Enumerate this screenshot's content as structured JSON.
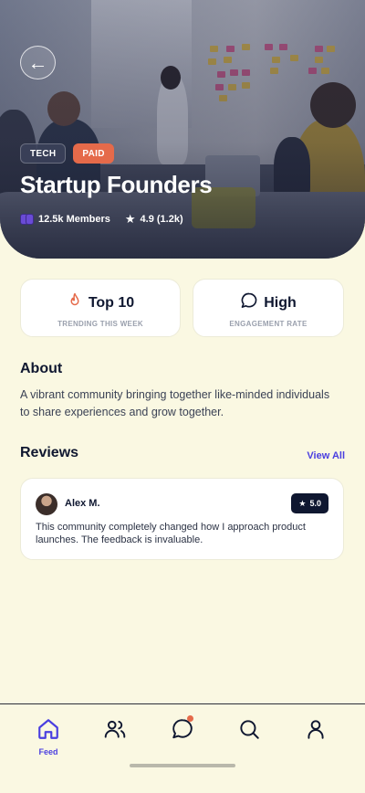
{
  "hero": {
    "back_icon": "arrow-left-icon",
    "tags": [
      "TECH",
      "PAID"
    ],
    "title": "Startup Founders",
    "members": "12.5k Members",
    "rating": "4.9 (1.2k)"
  },
  "stats": [
    {
      "icon": "flame-icon",
      "value": "Top 10",
      "label": "TRENDING THIS WEEK"
    },
    {
      "icon": "chat-bubble-icon",
      "value": "High",
      "label": "ENGAGEMENT RATE"
    }
  ],
  "about": {
    "title": "About",
    "text": "A vibrant community bringing together like-minded individuals to share experiences and grow together."
  },
  "reviews": {
    "title": "Reviews",
    "view_all": "View All",
    "items": [
      {
        "name": "Alex M.",
        "rating": "5.0",
        "text": "This community completely changed how I approach product launches. The feedback is invaluable."
      }
    ]
  },
  "nav": {
    "items": [
      {
        "icon": "home-icon",
        "label": "Feed",
        "active": true
      },
      {
        "icon": "users-icon",
        "label": ""
      },
      {
        "icon": "chat-icon",
        "label": ""
      },
      {
        "icon": "search-icon",
        "label": ""
      },
      {
        "icon": "profile-icon",
        "label": ""
      }
    ]
  },
  "colors": {
    "background": "#faf8e2",
    "accent": "#4a3fe0",
    "paid_tag": "#e56a4a",
    "dark": "#0f1730"
  }
}
